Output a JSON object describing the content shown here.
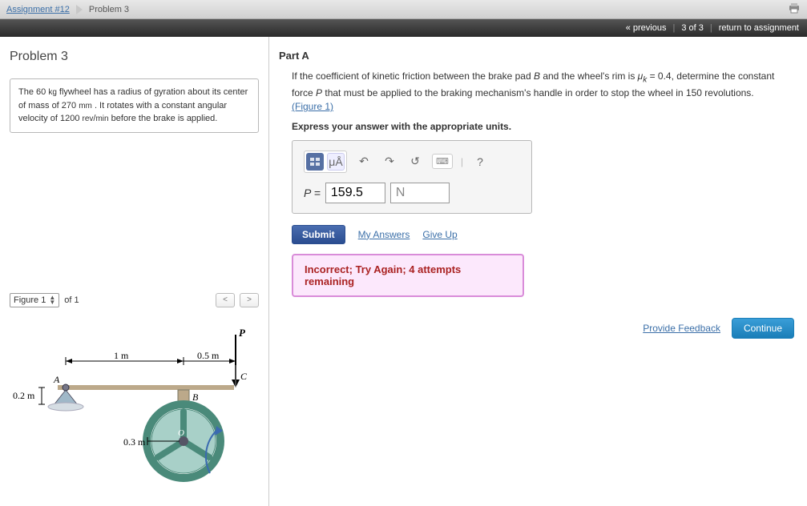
{
  "breadcrumb": {
    "assignment": "Assignment #12",
    "problem": "Problem 3"
  },
  "nav": {
    "prev": "« previous",
    "count": "3 of 3",
    "return": "return to assignment"
  },
  "problem": {
    "title": "Problem 3",
    "statement_pre": "The 60 ",
    "kg": "kg",
    "statement_mid1": " flywheel has a radius of gyration about its center of mass of 270 ",
    "mm": "mm",
    "statement_mid2": " . It rotates with a constant angular velocity of 1200 ",
    "rev": "rev",
    "slash": "/",
    "min": "min",
    "statement_end": " before the brake is applied."
  },
  "figure": {
    "selector": "Figure 1",
    "of": "of 1",
    "labels": {
      "P": "P",
      "C": "C",
      "B": "B",
      "A": "A",
      "O": "O",
      "d_1m": "1 m",
      "d_05m": "0.5 m",
      "d_02m": "0.2 m",
      "d_03m": "0.3 m"
    }
  },
  "partA": {
    "title": "Part A",
    "q_pre": "If the coefficient of kinetic friction between the brake pad ",
    "B": "B",
    "q_mid1": " and the wheel's rim is ",
    "muk": "μ",
    "sub_k": "k",
    "q_mid2": " = 0.4, determine the constant force ",
    "P": "P",
    "q_mid3": " that must be applied to the braking mechanism's handle in order to stop the wheel in 150 revolutions.",
    "figlink": "(Figure 1)",
    "express": "Express your answer with the appropriate units.",
    "toolbar": {
      "units_hint": "μÅ",
      "help": "?"
    },
    "answer_label_P": "P",
    "answer_label_eq": " = ",
    "answer_value": "159.5",
    "unit_value": "N",
    "submit": "Submit",
    "my_answers": "My Answers",
    "give_up": "Give Up",
    "feedback": "Incorrect; Try Again; 4 attempts remaining"
  },
  "footer": {
    "provide": "Provide Feedback",
    "continue": "Continue"
  }
}
